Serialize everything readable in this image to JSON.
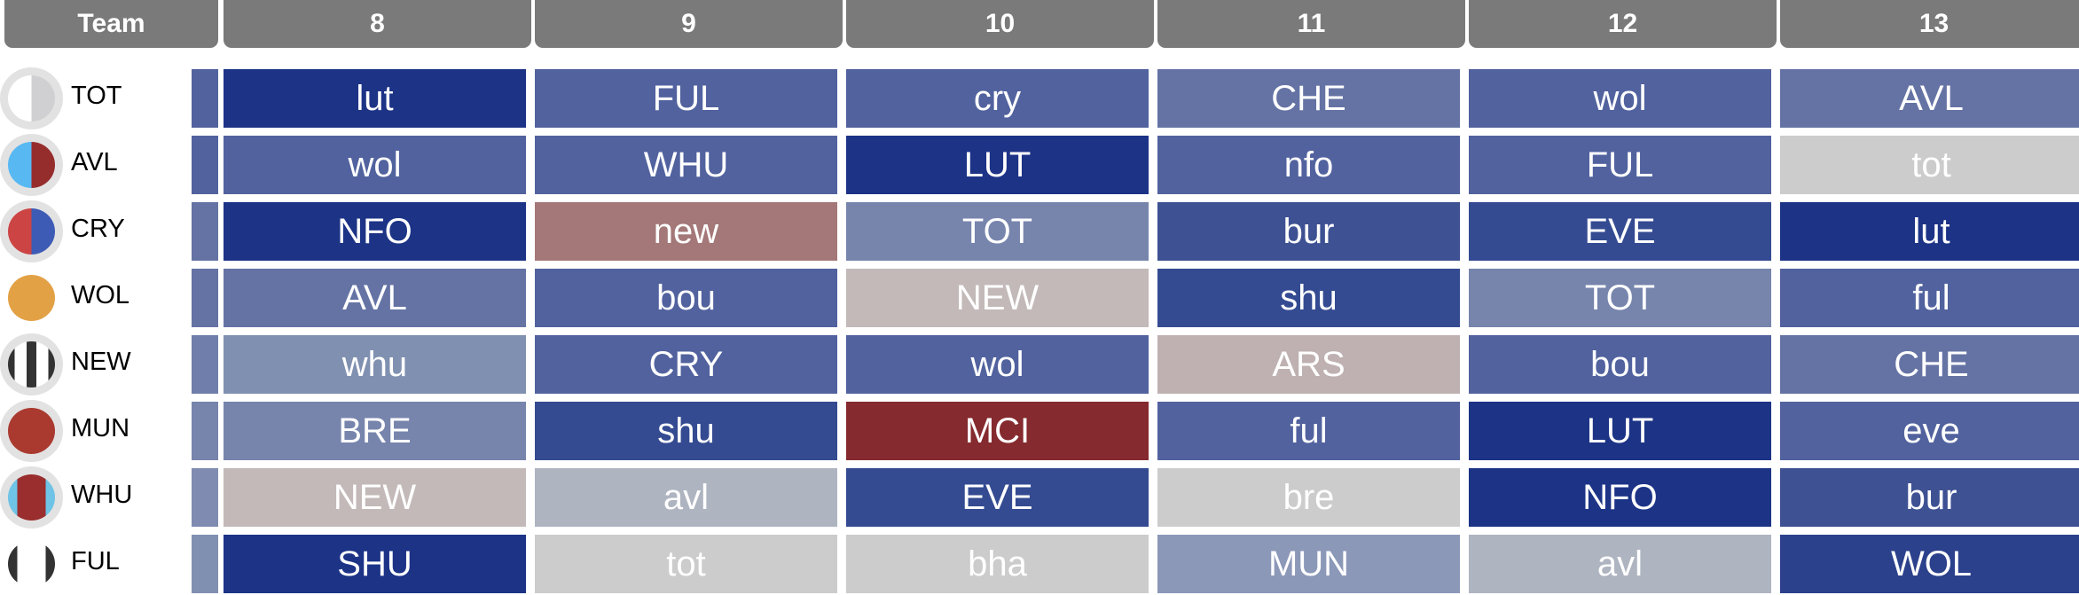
{
  "header": {
    "team_label": "Team",
    "gameweeks": [
      "8",
      "9",
      "10",
      "11",
      "12",
      "13"
    ]
  },
  "teams": [
    {
      "code": "TOT",
      "logo": "tot-crest",
      "strip_color": "#51629e",
      "fixtures": [
        {
          "t": "lut",
          "c": "#1c3386"
        },
        {
          "t": "FUL",
          "c": "#51629e"
        },
        {
          "t": "cry",
          "c": "#51629e"
        },
        {
          "t": "CHE",
          "c": "#6573a4"
        },
        {
          "t": "wol",
          "c": "#51629e"
        },
        {
          "t": "AVL",
          "c": "#6573a4"
        }
      ]
    },
    {
      "code": "AVL",
      "logo": "avl-crest",
      "strip_color": "#51629e",
      "fixtures": [
        {
          "t": "wol",
          "c": "#51629e"
        },
        {
          "t": "WHU",
          "c": "#51629e"
        },
        {
          "t": "LUT",
          "c": "#1c3386"
        },
        {
          "t": "nfo",
          "c": "#51629e"
        },
        {
          "t": "FUL",
          "c": "#51629e"
        },
        {
          "t": "tot",
          "c": "#cccccc"
        }
      ]
    },
    {
      "code": "CRY",
      "logo": "cry-crest",
      "strip_color": "#6573a4",
      "fixtures": [
        {
          "t": "NFO",
          "c": "#1c3386"
        },
        {
          "t": "new",
          "c": "#a47878"
        },
        {
          "t": "TOT",
          "c": "#7785ad"
        },
        {
          "t": "bur",
          "c": "#3d5193"
        },
        {
          "t": "EVE",
          "c": "#344b92"
        },
        {
          "t": "lut",
          "c": "#1c3386"
        }
      ]
    },
    {
      "code": "WOL",
      "logo": "wol-crest",
      "strip_color": "#6573a4",
      "fixtures": [
        {
          "t": "AVL",
          "c": "#6573a4"
        },
        {
          "t": "bou",
          "c": "#51629e"
        },
        {
          "t": "NEW",
          "c": "#c2b9b8"
        },
        {
          "t": "shu",
          "c": "#344b92"
        },
        {
          "t": "TOT",
          "c": "#7785ad"
        },
        {
          "t": "ful",
          "c": "#51629e"
        }
      ]
    },
    {
      "code": "NEW",
      "logo": "new-crest",
      "strip_color": "#6f7eaa",
      "fixtures": [
        {
          "t": "whu",
          "c": "#8090b0"
        },
        {
          "t": "CRY",
          "c": "#51629e"
        },
        {
          "t": "wol",
          "c": "#51629e"
        },
        {
          "t": "ARS",
          "c": "#bfb1b1"
        },
        {
          "t": "bou",
          "c": "#51629e"
        },
        {
          "t": "CHE",
          "c": "#6573a4"
        }
      ]
    },
    {
      "code": "MUN",
      "logo": "mun-crest",
      "strip_color": "#7785ad",
      "fixtures": [
        {
          "t": "BRE",
          "c": "#7785ad"
        },
        {
          "t": "shu",
          "c": "#344b92"
        },
        {
          "t": "MCI",
          "c": "#852a2e"
        },
        {
          "t": "ful",
          "c": "#51629e"
        },
        {
          "t": "LUT",
          "c": "#1c3386"
        },
        {
          "t": "eve",
          "c": "#51629e"
        }
      ]
    },
    {
      "code": "WHU",
      "logo": "whu-crest",
      "strip_color": "#7f8bb0",
      "fixtures": [
        {
          "t": "NEW",
          "c": "#c2b9b8"
        },
        {
          "t": "avl",
          "c": "#aeb4c0"
        },
        {
          "t": "EVE",
          "c": "#344b92"
        },
        {
          "t": "bre",
          "c": "#cccccc"
        },
        {
          "t": "NFO",
          "c": "#1c3386"
        },
        {
          "t": "bur",
          "c": "#3d5193"
        }
      ]
    },
    {
      "code": "FUL",
      "logo": "ful-crest",
      "strip_color": "#8090b0",
      "fixtures": [
        {
          "t": "SHU",
          "c": "#1c3386"
        },
        {
          "t": "tot",
          "c": "#cccccc"
        },
        {
          "t": "bha",
          "c": "#cccccc"
        },
        {
          "t": "MUN",
          "c": "#8c98b8"
        },
        {
          "t": "avl",
          "c": "#aeb4c0"
        },
        {
          "t": "WOL",
          "c": "#2c418c"
        }
      ]
    }
  ]
}
